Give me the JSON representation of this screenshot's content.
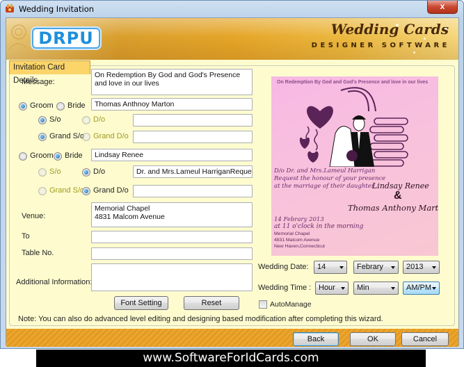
{
  "window": {
    "title": "Wedding Invitation",
    "close_label": "x"
  },
  "banner": {
    "logo": "DRPU",
    "product_title": "Wedding Cards",
    "product_subtitle": "DESIGNER SOFTWARE"
  },
  "tab": {
    "label": "Invitation Card Details"
  },
  "form": {
    "message_label": "Message:",
    "message_value": "On Redemption By God and God's Presence and love in our lives",
    "person1": {
      "groom_label": "Groom",
      "bride_label": "Bride",
      "selected": "Groom",
      "name_value": "Thomas Anthnoy Marton",
      "so_label": "S/o",
      "do_label": "D/o",
      "relation_selected": "S/o",
      "relation_value": "",
      "grand_so_label": "Grand S/o",
      "grand_do_label": "Grand D/o",
      "grand_selected": "Grand S/o",
      "grand_value": ""
    },
    "person2": {
      "groom_label": "Groom",
      "bride_label": "Bride",
      "selected": "Bride",
      "name_value": "Lindsay Renee",
      "so_label": "S/o",
      "do_label": "D/o",
      "relation_selected": "D/o",
      "relation_value": "Dr. and Mrs.Lameul HarriganRequest the",
      "grand_so_label": "Grand S/o",
      "grand_do_label": "Grand D/o",
      "grand_selected": "Grand D/o",
      "grand_value": ""
    },
    "venue_label": "Venue:",
    "venue_value": "Memorial Chapel\n4831 Malcom Avenue",
    "to_label": "To",
    "to_value": "",
    "table_label": "Table No.",
    "table_value": "",
    "additional_label": "Additional Information:",
    "additional_value": "",
    "font_setting_label": "Font Setting",
    "reset_label": "Reset"
  },
  "wedding": {
    "date_label": "Wedding Date:",
    "day": "14",
    "month": "Febrary",
    "year": "2013",
    "time_label": "Wedding Time :",
    "hour": "Hour",
    "min": "Min",
    "ampm": "AM/PM",
    "automanage_label": "AutoManage",
    "automanage_checked": false
  },
  "preview": {
    "message": "On Redemption By God and God's Presence and love in our lives",
    "parent_line": "D/o Dr. and Mrs.Lameul Harrigan",
    "request_line": "Request the honour of your presence",
    "marriage_line": "at the marriage of their daughter",
    "bride_name": "Lindsay Renee",
    "ampersand": "&",
    "groom_name": "Thomas Anthony Marton",
    "date_line": "14 Febrary 2013",
    "time_line": "at 11 o'clock in the morning",
    "venue_line1": "Memorial Chapel",
    "venue_line2": "4831 Malcom Avenue",
    "venue_line3": "New Haven,Connecticut"
  },
  "note": "Note: You can also do advanced level editing and designing based modification after completing this wizard.",
  "footer": {
    "back_label": "Back",
    "ok_label": "OK",
    "cancel_label": "Cancel"
  },
  "website": "www.SoftwareForIdCards.com"
}
